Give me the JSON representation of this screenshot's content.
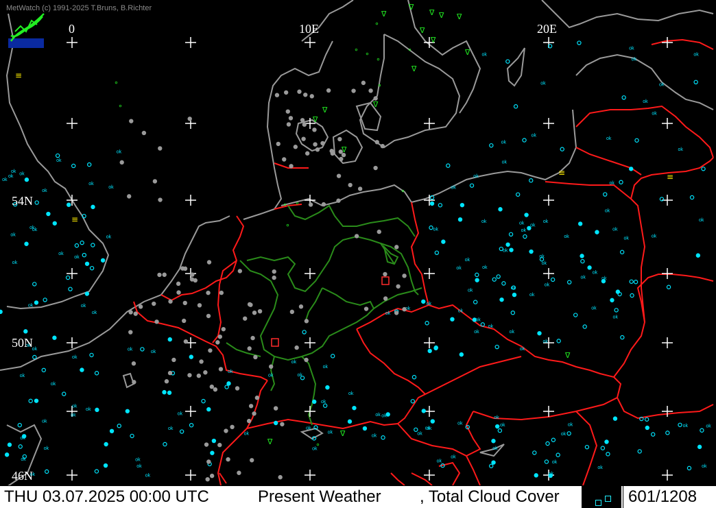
{
  "credit": "MetWatch  (c) 1991-2025 T.Bruns, B.Richter",
  "lon_labels": [
    {
      "text": "0",
      "lon": 0
    },
    {
      "text": "10E",
      "lon": 10
    },
    {
      "text": "20E",
      "lon": 20
    }
  ],
  "lat_labels": [
    {
      "text": "54N",
      "lat": 54
    },
    {
      "text": "50N",
      "lat": 50
    },
    {
      "text": "46N",
      "lat": 46
    }
  ],
  "status": {
    "datetime": "THU 03.07.2025 00:00 UTC",
    "product": "Present Weather",
    "overlay": ", Total Cloud Cover",
    "count": "601/1208"
  },
  "colors": {
    "background": "#000000",
    "coastline": "#9a9a9a",
    "border": "#ff1a1a",
    "state_border": "#2a8c1a",
    "grid": "#ffffff",
    "station_clear": "#00e5ff",
    "station_cloudy": "#9a9a9a",
    "weather_green": "#22ee22",
    "weather_yellow": "#ffee00",
    "weather_red": "#ff2a2a"
  },
  "icons": {
    "logo": "metwatch-logo",
    "grid_marker": "plus-marker"
  }
}
